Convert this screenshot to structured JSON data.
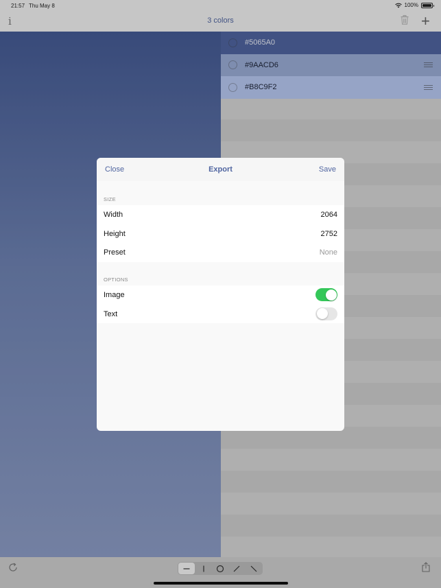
{
  "status_bar": {
    "time": "21:57",
    "date": "Thu May 8",
    "battery_percent": "100%",
    "battery_level": 1.0
  },
  "nav": {
    "title": "3 colors"
  },
  "colors": [
    {
      "hex": "#5065A0",
      "color": "#5065a0",
      "text_color": "#e8ecf6",
      "selected": false,
      "show_handle": false
    },
    {
      "hex": "#9AACD6",
      "color": "#9aacd6",
      "text_color": "#1d2438",
      "selected": false,
      "show_handle": true
    },
    {
      "hex": "#B8C9F2",
      "color": "#b8c9f2",
      "text_color": "#1d2438",
      "selected": false,
      "show_handle": true
    }
  ],
  "export_dialog": {
    "close_label": "Close",
    "title": "Export",
    "save_label": "Save",
    "size_section": "SIZE",
    "width_label": "Width",
    "width_value": "2064",
    "height_label": "Height",
    "height_value": "2752",
    "preset_label": "Preset",
    "preset_value": "None",
    "options_section": "OPTIONS",
    "image_label": "Image",
    "image_enabled": true,
    "text_label": "Text",
    "text_enabled": false
  },
  "toolbar": {
    "segments": [
      "horizontal-line-icon",
      "vertical-line-icon",
      "circle-icon",
      "diagonal-up-icon",
      "diagonal-down-icon"
    ],
    "selected_segment": 0
  },
  "theme": {
    "accent": "#5065a0",
    "toggle_on": "#34c759"
  }
}
